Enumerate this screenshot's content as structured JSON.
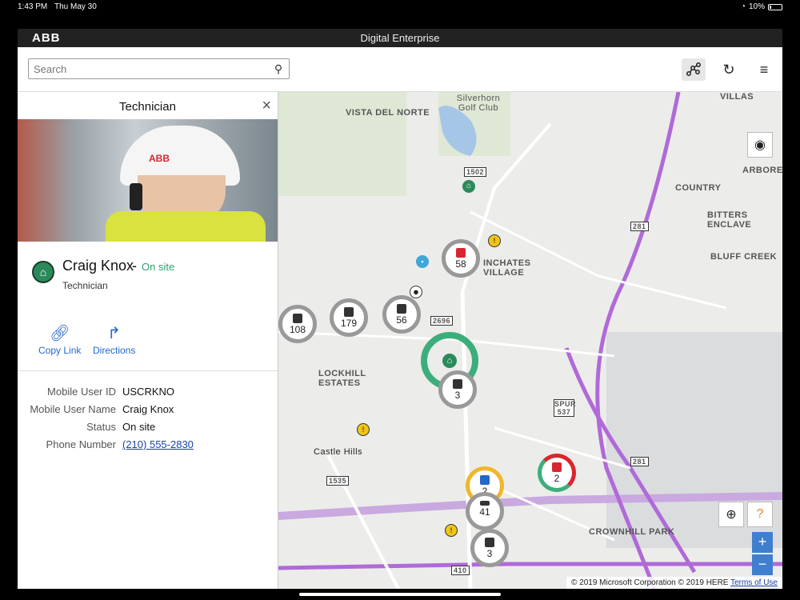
{
  "statusbar": {
    "time": "1:43 PM",
    "date": "Thu May 30",
    "battery": "10%"
  },
  "header": {
    "logo": "ABB",
    "title": "Digital Enterprise"
  },
  "search": {
    "placeholder": "Search"
  },
  "panel": {
    "title": "Technician",
    "photo_text": "ABB",
    "name": "Craig Knox",
    "dash": "-",
    "status": "On site",
    "role": "Technician",
    "actions": {
      "copy_link": "Copy Link",
      "directions": "Directions"
    },
    "details": [
      {
        "key": "Mobile User ID",
        "value": "USCRKNO"
      },
      {
        "key": "Mobile User Name",
        "value": "Craig Knox"
      },
      {
        "key": "Status",
        "value": "On site"
      },
      {
        "key": "Phone Number",
        "value": "(210) 555-2830"
      }
    ]
  },
  "map": {
    "labels": {
      "silverhorn": "Silverhorn Golf Club",
      "vista": "VISTA DEL NORTE",
      "villas": "VILLAS",
      "arboreta": "ARBORETA",
      "country": "COUNTRY",
      "bitters": "BITTERS ENCLAVE",
      "bluff": "BLUFF CREEK",
      "inchates": "INCHATES VILLAGE",
      "lockhill": "LOCKHILL ESTATES",
      "castle": "Castle Hills",
      "crownhill": "CROWNHILL PARK",
      "spur537": "SPUR 537",
      "r281": "281",
      "r1502": "1502",
      "r2696": "2696",
      "r1535": "1535",
      "r410": "410"
    },
    "clusters": [
      {
        "count": "108"
      },
      {
        "count": "179"
      },
      {
        "count": "56"
      },
      {
        "count": "58"
      },
      {
        "count": "3"
      },
      {
        "count": "2"
      },
      {
        "count": "41"
      },
      {
        "count": "2"
      },
      {
        "count": "3"
      }
    ],
    "attribution": "© 2019 Microsoft Corporation © 2019 HERE",
    "terms": "Terms of Use",
    "zoom_in": "+",
    "zoom_out": "−"
  },
  "colors": {
    "accent": "#2468c8",
    "status_green": "#2ea06a",
    "route": "#b06ad8"
  }
}
